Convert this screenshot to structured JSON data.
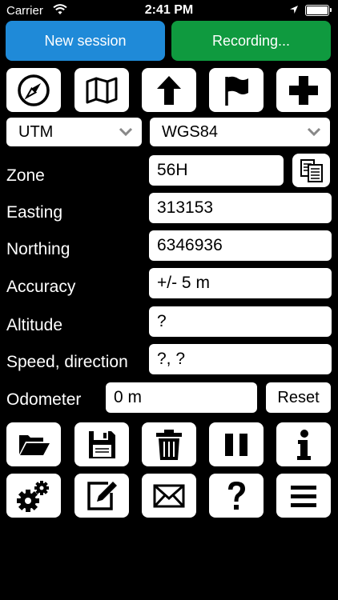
{
  "status_bar": {
    "carrier": "Carrier",
    "time": "2:41 PM"
  },
  "session": {
    "new_label": "New session",
    "recording_label": "Recording..."
  },
  "toolbar_top": [
    "compass-icon",
    "map-icon",
    "arrow-up-icon",
    "flag-icon",
    "plus-icon"
  ],
  "projection": {
    "selected": "UTM"
  },
  "datum": {
    "selected": "WGS84"
  },
  "fields": {
    "zone": {
      "label": "Zone",
      "value": "56H"
    },
    "easting": {
      "label": "Easting",
      "value": "313153"
    },
    "northing": {
      "label": "Northing",
      "value": "6346936"
    },
    "accuracy": {
      "label": "Accuracy",
      "value": "+/- 5 m"
    },
    "altitude": {
      "label": "Altitude",
      "value": "?"
    },
    "speed": {
      "label": "Speed, direction",
      "value": "?, ?"
    }
  },
  "odometer": {
    "label": "Odometer",
    "value": "0 m",
    "reset_label": "Reset"
  },
  "toolbar_bottom_row1": [
    "folder-open-icon",
    "save-icon",
    "trash-icon",
    "pause-icon",
    "info-icon"
  ],
  "toolbar_bottom_row2": [
    "settings-gears-icon",
    "edit-icon",
    "mail-icon",
    "help-icon",
    "menu-icon"
  ],
  "colors": {
    "new_session": "#1f8ad8",
    "recording": "#0f9a3f",
    "background": "#000000"
  }
}
